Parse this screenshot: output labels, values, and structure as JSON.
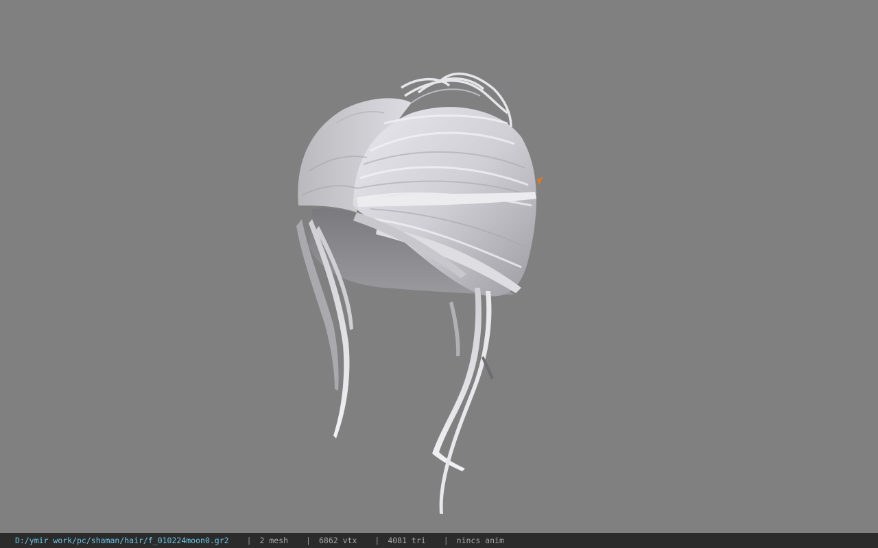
{
  "viewport": {
    "background": "#808080",
    "model_color": "#d8d8dc",
    "accent_color": "#d97a2b"
  },
  "statusbar": {
    "file_path": "D:/ymir work/pc/shaman/hair/f_010224moon0.gr2",
    "separator": "|",
    "mesh": "2 mesh",
    "vtx": "6862 vtx",
    "tri": "4081 tri",
    "anim": "nincs anim"
  }
}
